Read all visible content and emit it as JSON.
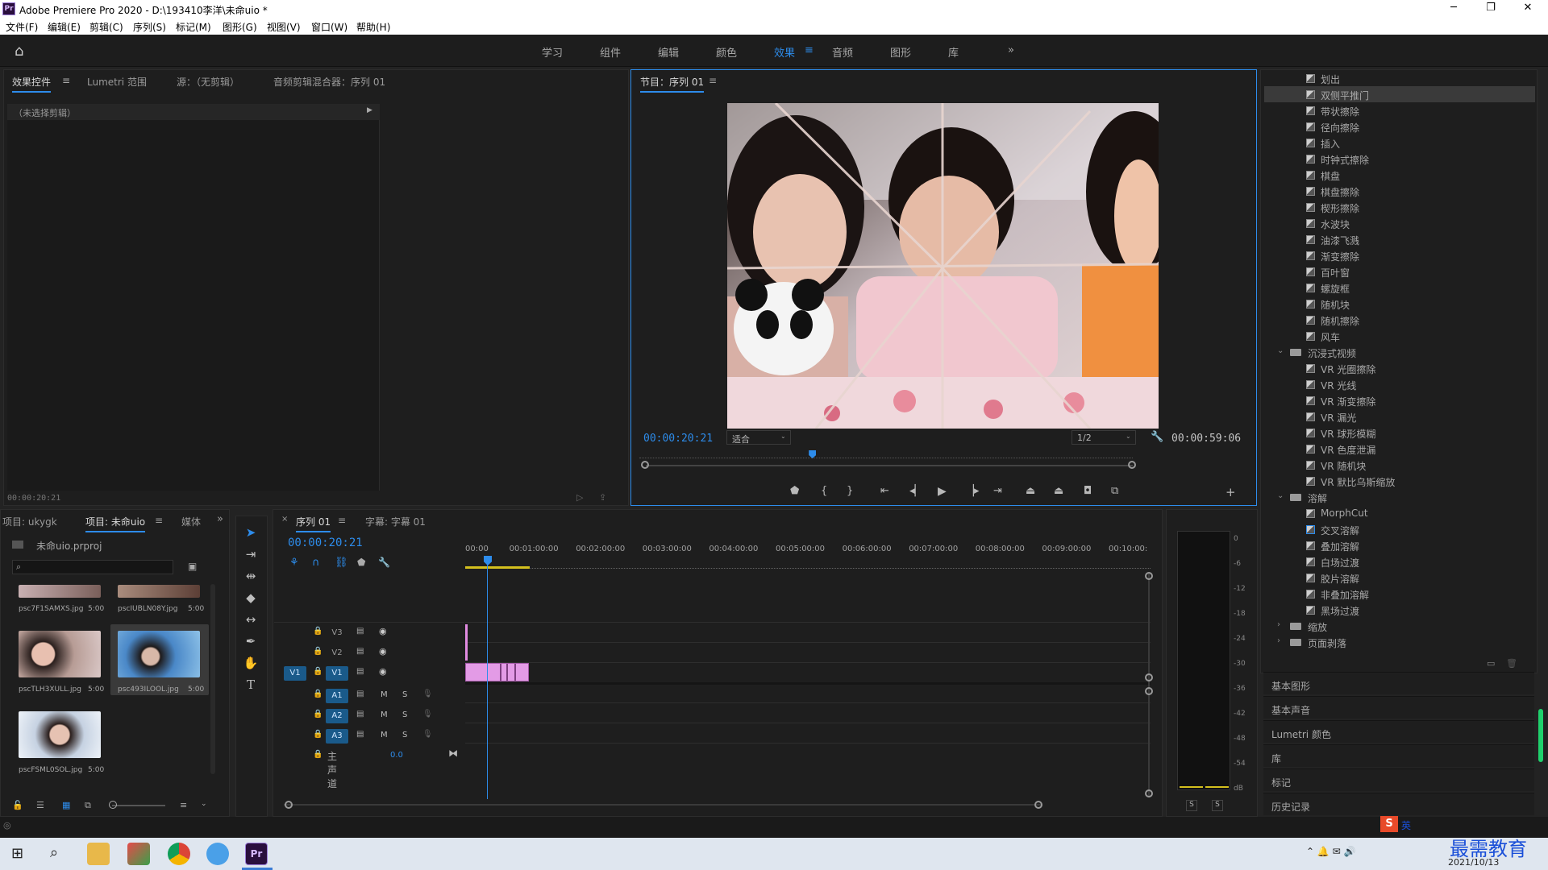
{
  "app": {
    "title": "Adobe Premiere Pro 2020 - D:\\193410李洋\\未命uio *",
    "logo": "Pr"
  },
  "menu": [
    "文件(F)",
    "编辑(E)",
    "剪辑(C)",
    "序列(S)",
    "标记(M)",
    "图形(G)",
    "视图(V)",
    "窗口(W)",
    "帮助(H)"
  ],
  "workspaces": {
    "tabs": [
      "学习",
      "组件",
      "编辑",
      "颜色",
      "效果",
      "音频",
      "图形",
      "库"
    ],
    "active": "效果",
    "more": "»"
  },
  "source_panel": {
    "tabs": [
      "效果控件",
      "Lumetri 范围",
      "源：（无剪辑）",
      "音频剪辑混合器：序列 01"
    ],
    "clip_selector": "（未选择剪辑）",
    "timecode": "00:00:20:21"
  },
  "program_monitor": {
    "title": "节目：序列 01",
    "timecode": "00:00:20:21",
    "fit": "适合",
    "resolution": "1/2",
    "duration": "00:00:59:06",
    "playhead_fraction": 0.35
  },
  "effects_tree": {
    "items": [
      {
        "label": "划出",
        "type": "effect"
      },
      {
        "label": "双侧平推门",
        "type": "effect",
        "selected": true
      },
      {
        "label": "带状擦除",
        "type": "effect"
      },
      {
        "label": "径向擦除",
        "type": "effect"
      },
      {
        "label": "插入",
        "type": "effect"
      },
      {
        "label": "时钟式擦除",
        "type": "effect"
      },
      {
        "label": "棋盘",
        "type": "effect"
      },
      {
        "label": "棋盘擦除",
        "type": "effect"
      },
      {
        "label": "楔形擦除",
        "type": "effect"
      },
      {
        "label": "水波块",
        "type": "effect"
      },
      {
        "label": "油漆飞溅",
        "type": "effect"
      },
      {
        "label": "渐变擦除",
        "type": "effect"
      },
      {
        "label": "百叶窗",
        "type": "effect"
      },
      {
        "label": "螺旋框",
        "type": "effect"
      },
      {
        "label": "随机块",
        "type": "effect"
      },
      {
        "label": "随机擦除",
        "type": "effect"
      },
      {
        "label": "风车",
        "type": "effect"
      },
      {
        "label": "沉浸式视频",
        "type": "folder",
        "open": true
      },
      {
        "label": "VR 光圈擦除",
        "type": "effect"
      },
      {
        "label": "VR 光线",
        "type": "effect"
      },
      {
        "label": "VR 渐变擦除",
        "type": "effect"
      },
      {
        "label": "VR 漏光",
        "type": "effect"
      },
      {
        "label": "VR 球形模糊",
        "type": "effect"
      },
      {
        "label": "VR 色度泄漏",
        "type": "effect"
      },
      {
        "label": "VR 随机块",
        "type": "effect"
      },
      {
        "label": "VR 默比乌斯缩放",
        "type": "effect"
      },
      {
        "label": "溶解",
        "type": "folder",
        "open": true
      },
      {
        "label": "MorphCut",
        "type": "effect"
      },
      {
        "label": "交叉溶解",
        "type": "effect",
        "outlined": true
      },
      {
        "label": "叠加溶解",
        "type": "effect"
      },
      {
        "label": "白场过渡",
        "type": "effect"
      },
      {
        "label": "胶片溶解",
        "type": "effect"
      },
      {
        "label": "非叠加溶解",
        "type": "effect"
      },
      {
        "label": "黑场过渡",
        "type": "effect"
      },
      {
        "label": "缩放",
        "type": "folder",
        "open": false
      },
      {
        "label": "页面剥落",
        "type": "folder",
        "open": false
      }
    ]
  },
  "side_sections": [
    "基本图形",
    "基本声音",
    "Lumetri 颜色",
    "库",
    "标记",
    "历史记录"
  ],
  "project_panel": {
    "tabs": [
      "项目: ukygk",
      "项目: 未命uio",
      "媒体"
    ],
    "project_file": "未命uio.prproj",
    "items": [
      {
        "name": "psc7F1SAMXS.jpg",
        "duration": "5:00"
      },
      {
        "name": "pscIUBLN08Y.jpg",
        "duration": "5:00"
      },
      {
        "name": "pscTLH3XULL.jpg",
        "duration": "5:00"
      },
      {
        "name": "psc493ILOOL.jpg",
        "duration": "5:00"
      },
      {
        "name": "pscFSML0SOL.jpg",
        "duration": "5:00"
      }
    ]
  },
  "timeline": {
    "tabs": [
      "序列 01",
      "字幕: 字幕 01"
    ],
    "timecode": "00:00:20:21",
    "ruler": [
      "00:00",
      "00:01:00:00",
      "00:02:00:00",
      "00:03:00:00",
      "00:04:00:00",
      "00:05:00:00",
      "00:06:00:00",
      "00:07:00:00",
      "00:08:00:00",
      "00:09:00:00",
      "00:10:00:"
    ],
    "video_tracks": [
      "V3",
      "V2",
      "V1"
    ],
    "audio_tracks": [
      "A1",
      "A2",
      "A3"
    ],
    "source_patch": "V1",
    "master_label": "主声道",
    "master_value": "0.0",
    "track_m": "M",
    "track_s": "S"
  },
  "meter": {
    "scale": [
      "0",
      "-6",
      "-12",
      "-18",
      "-24",
      "-30",
      "-36",
      "-42",
      "-48",
      "-54",
      "dB"
    ],
    "solo": [
      "S",
      "S"
    ]
  },
  "taskbar": {
    "date": "2021/10/13",
    "watermark": "最需教育",
    "ime": "英"
  }
}
